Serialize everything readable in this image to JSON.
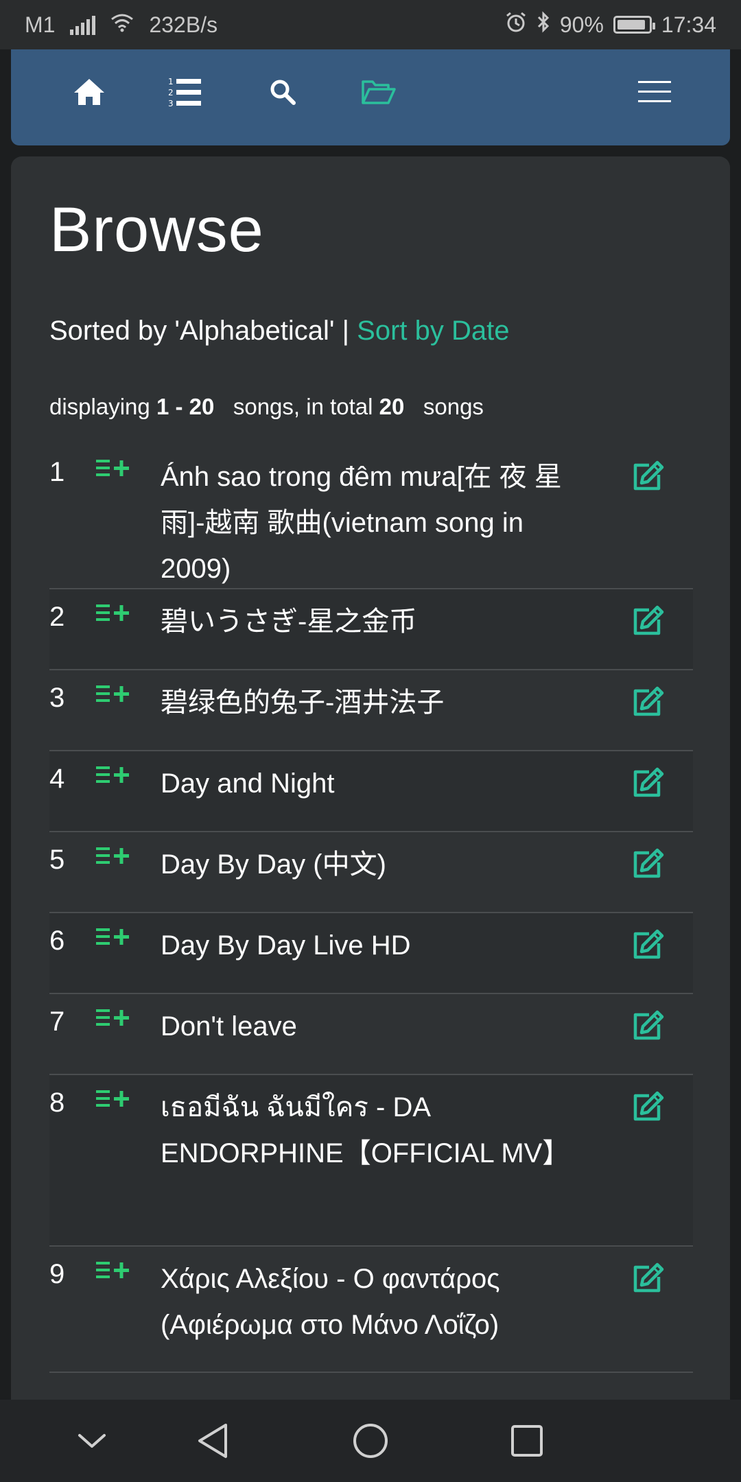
{
  "status_bar": {
    "carrier": "M1",
    "speed": "232B/s",
    "battery": "90%",
    "battery_level": 0.9,
    "time": "17:34"
  },
  "navbar": {
    "icons": [
      "home-icon",
      "numbered-list-icon",
      "search-icon",
      "folder-open-icon",
      "hamburger-menu-icon"
    ],
    "active_color": "#2bbf9c"
  },
  "page": {
    "title": "Browse",
    "sorted_by": "Sorted by 'Alphabetical' |",
    "sort_link": "Sort by Date",
    "count_prefix": "displaying",
    "count_range": "1 - 20",
    "count_middle": "songs, in total",
    "count_total": "20",
    "count_suffix": "songs"
  },
  "songs": [
    {
      "num": "1",
      "title": "Ánh sao trong đêm mưa[在 夜 星 雨]-越南 歌曲(vietnam song in 2009)"
    },
    {
      "num": "2",
      "title": "碧いうさぎ-星之金币"
    },
    {
      "num": "3",
      "title": "碧绿色的兔子-酒井法子"
    },
    {
      "num": "4",
      "title": "Day and Night"
    },
    {
      "num": "5",
      "title": "Day By Day (中文)"
    },
    {
      "num": "6",
      "title": "Day By Day Live HD"
    },
    {
      "num": "7",
      "title": "Don't leave"
    },
    {
      "num": "8",
      "title": "เธอมีฉัน ฉันมีใคร - DA ENDORPHINE【OFFICIAL MV】"
    },
    {
      "num": "9",
      "title": "Χάρις Αλεξίου - Ο φαντάρος (Αφιέρωμα στο Μάνο Λοΐζο)"
    }
  ],
  "colors": {
    "accent": "#2bbf9c",
    "queue_green": "#2ecc71",
    "navbar": "#375a7f",
    "card": "#2f3234"
  }
}
